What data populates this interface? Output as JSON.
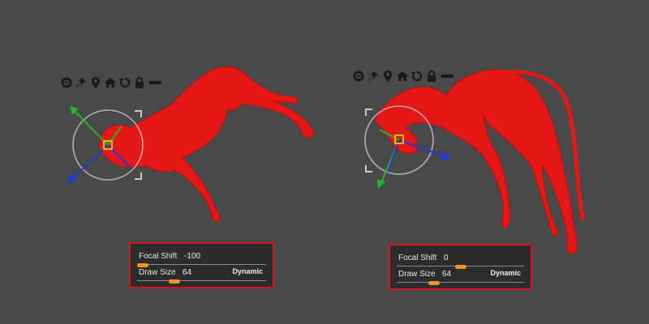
{
  "toolbar_icons": [
    "gear-icon",
    "pin-icon",
    "location-icon",
    "home-icon",
    "rotate-icon",
    "lock-icon",
    "toggle-icon"
  ],
  "panels": [
    {
      "focal_shift": {
        "label": "Focal Shift",
        "value": "-100",
        "level": 0.0
      },
      "draw_size": {
        "label": "Draw Size",
        "value": "64",
        "level": 0.27
      },
      "dynamic_label": "Dynamic"
    },
    {
      "focal_shift": {
        "label": "Focal Shift",
        "value": "0",
        "level": 0.5
      },
      "draw_size": {
        "label": "Draw Size",
        "value": "64",
        "level": 0.27
      },
      "dynamic_label": "Dynamic"
    }
  ],
  "colors": {
    "background": "#494949",
    "model": "#e61717",
    "panel_border": "#d6161b",
    "slider_knob": "#f0961e",
    "gizmo_x": "#1a3fd0",
    "gizmo_y": "#22b52b",
    "gizmo_ring": "#b4b4b4"
  }
}
